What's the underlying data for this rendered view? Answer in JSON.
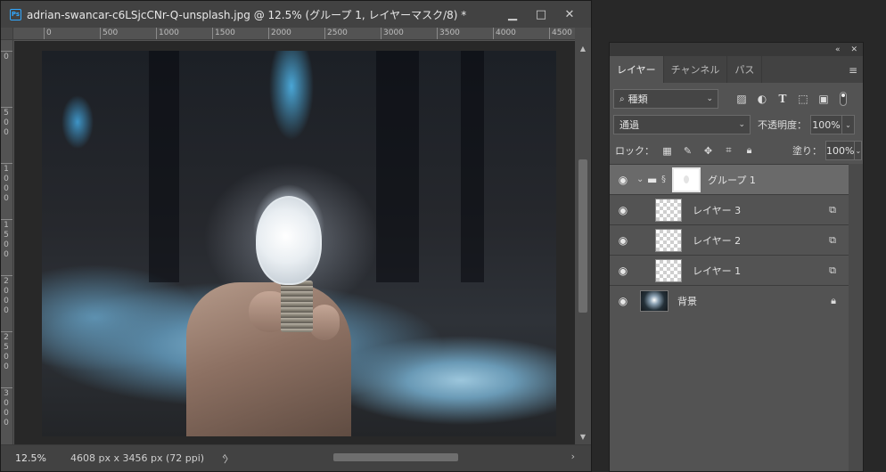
{
  "document": {
    "title": "adrian-swancar-c6LSjcCNr-Q-unsplash.jpg @ 12.5% (グループ 1, レイヤーマスク/8) *",
    "app_badge": "Ps",
    "window_buttons": {
      "minimize": "▁",
      "maximize": "□",
      "close": "✕"
    },
    "ruler_top_labels": [
      "0",
      "500",
      "1000",
      "1500",
      "2000",
      "2500",
      "3000",
      "3500",
      "4000",
      "4500"
    ],
    "ruler_left_labels": [
      "0",
      "500",
      "1000",
      "1500",
      "2000",
      "2500",
      "3000"
    ],
    "zoom": "12.5%",
    "doc_info": "4608 px x 3456 px (72 ppi)",
    "status_arrow": "〉",
    "scroll_left": "‹",
    "scroll_right": "›",
    "scroll_up": "▲",
    "scroll_down": "▼"
  },
  "panel": {
    "collapse_icon": "«",
    "close_icon": "✕",
    "tabs": [
      {
        "label": "レイヤー"
      },
      {
        "label": "チャンネル"
      },
      {
        "label": "パス"
      }
    ],
    "menu_icon": "≡",
    "filter_kind": "種類",
    "filter_search_icon": "🔍",
    "blend_mode": "通過",
    "opacity_label": "不透明度：",
    "opacity_value": "100%",
    "lock_label": "ロック：",
    "fill_label": "塗り：",
    "fill_value": "100%",
    "layers": [
      {
        "name": "グループ 1",
        "type": "group"
      },
      {
        "name": "レイヤー 3",
        "type": "layer"
      },
      {
        "name": "レイヤー 2",
        "type": "layer"
      },
      {
        "name": "レイヤー 1",
        "type": "layer"
      },
      {
        "name": "背景",
        "type": "background"
      }
    ]
  }
}
